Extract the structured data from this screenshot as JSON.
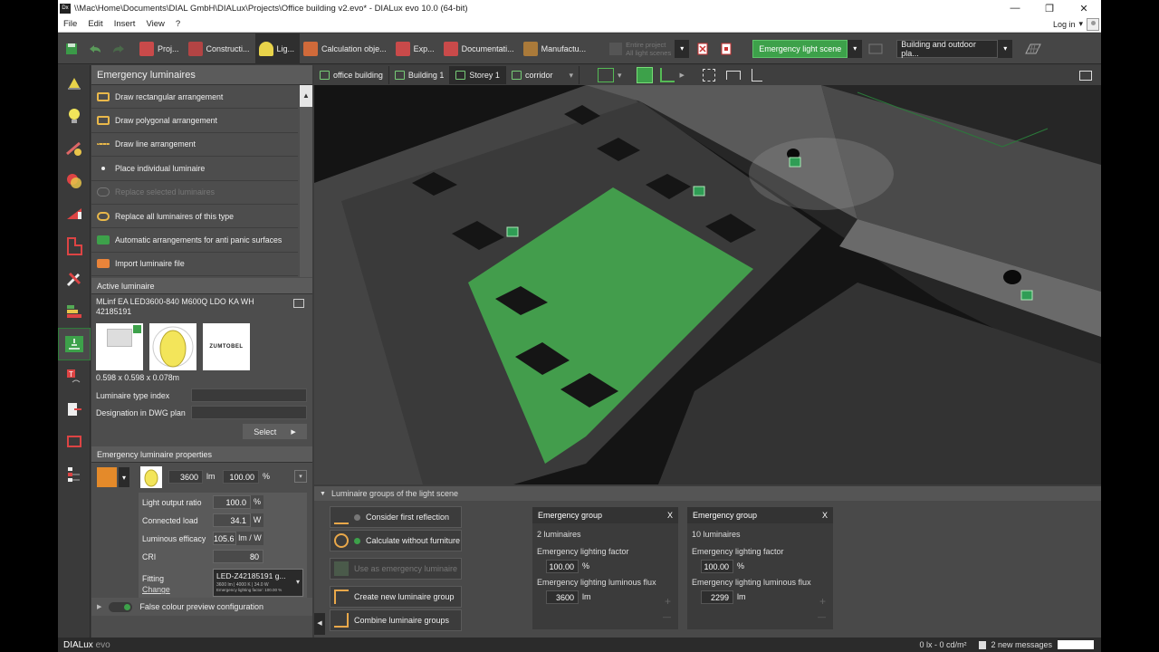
{
  "window": {
    "app_badge": "Dx",
    "title": "\\\\Mac\\Home\\Documents\\DIAL GmbH\\DIALux\\Projects\\Office building v2.evo* - DIALux evo 10.0  (64-bit)",
    "minimize": "—",
    "maximize": "❐",
    "close": "✕"
  },
  "menu": {
    "items": [
      "File",
      "Edit",
      "Insert",
      "View",
      "?"
    ],
    "login": "Log in"
  },
  "toolbar": {
    "tabs": [
      {
        "label": "Proj...",
        "color": "#c94a4a"
      },
      {
        "label": "Constructi...",
        "color": "#c94a4a"
      },
      {
        "label": "Lig...",
        "color": "#e8d34a"
      },
      {
        "label": "Calculation obje...",
        "color": "#d06a3a"
      },
      {
        "label": "Exp...",
        "color": "#c94a4a"
      },
      {
        "label": "Documentati...",
        "color": "#c94a4a"
      },
      {
        "label": "Manufactu...",
        "color": "#aa7a3a"
      }
    ],
    "active_tab_index": 2,
    "filter_line1": "Entire project",
    "filter_line2": "All light scenes",
    "scene": "Emergency light scene",
    "view_select": "Building and outdoor pla..."
  },
  "left_panel": {
    "title": "Emergency luminaires",
    "actions": [
      {
        "label": "Draw rectangular arrangement",
        "enabled": true
      },
      {
        "label": "Draw polygonal arrangement",
        "enabled": true
      },
      {
        "label": "Draw line arrangement",
        "enabled": true
      },
      {
        "label": "Place individual luminaire",
        "enabled": true
      },
      {
        "label": "Replace selected luminaires",
        "enabled": false
      },
      {
        "label": "Replace all luminaires of this type",
        "enabled": true
      },
      {
        "label": "Automatic arrangements for anti panic surfaces",
        "enabled": true
      },
      {
        "label": "Import luminaire file",
        "enabled": true
      }
    ],
    "active_luminaire": {
      "title": "Active luminaire",
      "name": "MLinf EA LED3600-840 M600Q LDO KA WH",
      "article": "42185191",
      "brand": "ZUMTOBEL",
      "dimensions": "0.598 x 0.598 x 0.078m",
      "type_index_label": "Luminaire type index",
      "designation_label": "Designation in DWG plan",
      "select_label": "Select"
    },
    "properties": {
      "title": "Emergency luminaire properties",
      "flux": "3600",
      "flux_unit": "lm",
      "factor": "100.00",
      "factor_unit": "%",
      "rows": [
        {
          "label": "Light output ratio",
          "value": "100.0",
          "unit": "%"
        },
        {
          "label": "Connected load",
          "value": "34.1",
          "unit": "W"
        },
        {
          "label": "Luminous efficacy",
          "value": "105.6",
          "unit": "lm / W"
        },
        {
          "label": "CRI",
          "value": "80",
          "unit": ""
        }
      ],
      "fitting_label": "Fitting",
      "change_label": "Change",
      "fitting_name": "LED-Z42185191 g...",
      "fitting_detail": "3600 lm  |  4000 K  |  34.0 W",
      "fitting_detail2": "Emergency lighting factor: 100.00 %"
    },
    "false_colour": "False colour preview configuration"
  },
  "viewport": {
    "breadcrumbs": [
      "office building",
      "Building 1",
      "Storey 1",
      "corridor"
    ],
    "active_crumb_index": 2
  },
  "groups_panel": {
    "title": "Luminaire groups of the light scene",
    "buttons": [
      {
        "label": "Consider first reflection",
        "enabled": true
      },
      {
        "label": "Calculate without furniture",
        "enabled": true
      },
      {
        "label": "Use as emergency luminaire",
        "enabled": false
      },
      {
        "label": "Create new luminaire group",
        "enabled": true
      },
      {
        "label": "Combine luminaire groups",
        "enabled": true
      }
    ],
    "groups": [
      {
        "title": "Emergency group",
        "count": "2 luminaires",
        "factor_label": "Emergency lighting factor",
        "factor": "100.00",
        "factor_unit": "%",
        "flux_label": "Emergency lighting luminous flux",
        "flux": "3600",
        "flux_unit": "lm"
      },
      {
        "title": "Emergency group",
        "count": "10 luminaires",
        "factor_label": "Emergency lighting factor",
        "factor": "100.00",
        "factor_unit": "%",
        "flux_label": "Emergency lighting luminous flux",
        "flux": "2299",
        "flux_unit": "lm"
      }
    ],
    "close": "X",
    "plus": "+",
    "minus": "—"
  },
  "status": {
    "logo_a": "DIALux",
    "logo_b": "evo",
    "readout": "0 lx - 0 cd/m²",
    "messages": "2 new messages"
  },
  "colors": {
    "accent_green": "#3da14a"
  }
}
